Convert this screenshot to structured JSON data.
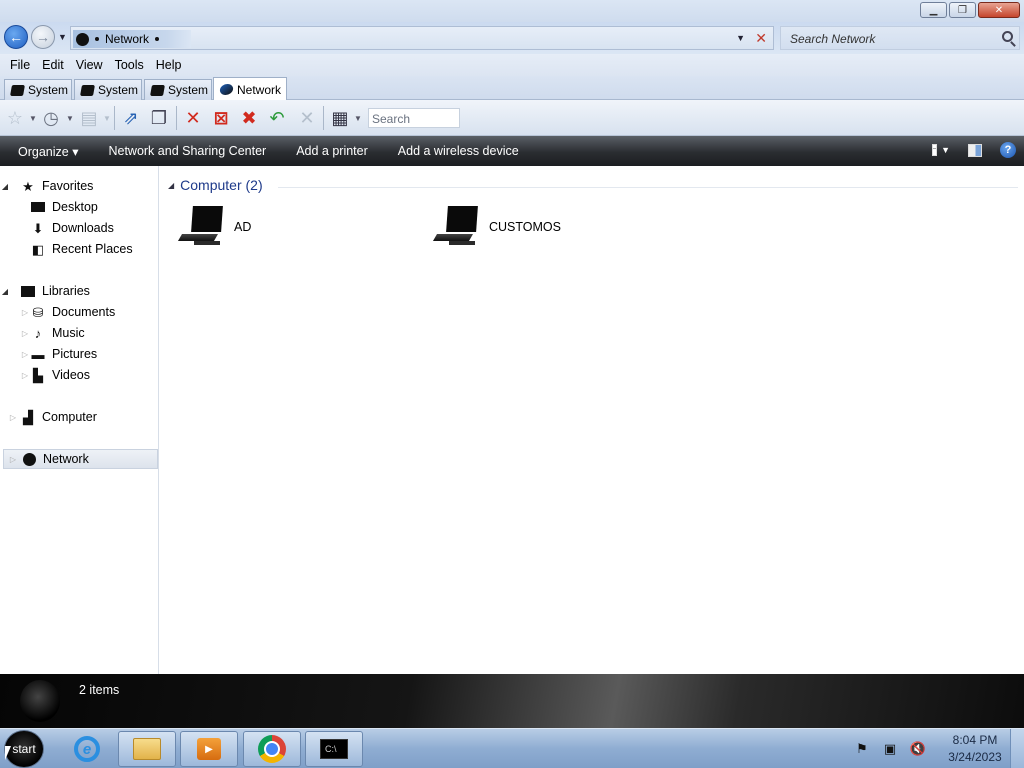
{
  "window": {
    "title_buttons": [
      "minimize",
      "maximize",
      "close"
    ]
  },
  "address": {
    "crumb": "Network",
    "search_placeholder": "Search Network"
  },
  "menu": [
    "File",
    "Edit",
    "View",
    "Tools",
    "Help"
  ],
  "tabs": [
    {
      "label": "System",
      "active": false
    },
    {
      "label": "System",
      "active": false
    },
    {
      "label": "System",
      "active": false
    },
    {
      "label": "Network",
      "active": true
    }
  ],
  "toolbar": {
    "search_placeholder": "Search"
  },
  "commands": {
    "organize": "Organize ▾",
    "items": [
      "Network and Sharing Center",
      "Add a printer",
      "Add a wireless device"
    ]
  },
  "nav": {
    "favorites": {
      "label": "Favorites",
      "items": [
        "Desktop",
        "Downloads",
        "Recent Places"
      ]
    },
    "libraries": {
      "label": "Libraries",
      "items": [
        "Documents",
        "Music",
        "Pictures",
        "Videos"
      ]
    },
    "computer": "Computer",
    "network": "Network"
  },
  "content": {
    "group_header": "Computer (2)",
    "items": [
      "AD",
      "CUSTOMOS"
    ]
  },
  "details": {
    "count": "2 items"
  },
  "taskbar": {
    "start_label": "start",
    "apps": [
      "internet-explorer",
      "windows-explorer",
      "media-player",
      "chrome",
      "terminal"
    ],
    "clock": {
      "time": "8:04 PM",
      "date": "3/24/2023"
    }
  },
  "colors": {
    "command_bar": "#2a2d31",
    "group_header_text": "#1e3a8a",
    "taskbar": "#8fadd2"
  }
}
